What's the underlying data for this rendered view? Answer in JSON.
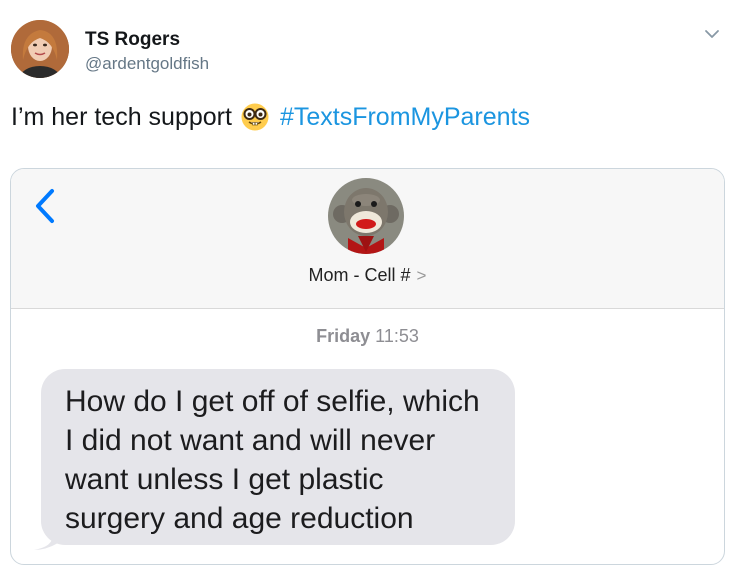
{
  "tweet": {
    "author_name": "TS Rogers",
    "author_handle": "@ardentgoldfish",
    "text": "I’m her tech support",
    "emoji": "nerd-face-emoji",
    "hashtag": "#TextsFromMyParents",
    "menu_icon": "chevron-down-icon"
  },
  "image": {
    "header": {
      "back_icon": "chevron-left-icon",
      "contact_name": "Mom - Cell #",
      "contact_arrow": ">"
    },
    "timestamp": {
      "day": "Friday",
      "time": "11:53"
    },
    "message": {
      "lines": [
        "How do I get off of selfie, which",
        "I did not want and will never",
        "want unless I get plastic",
        "surgery and age reduction"
      ]
    }
  },
  "colors": {
    "hashtag": "#1b95e0",
    "ios_blue": "#007aff",
    "bubble": "#e5e5ea",
    "handle": "#657786"
  }
}
